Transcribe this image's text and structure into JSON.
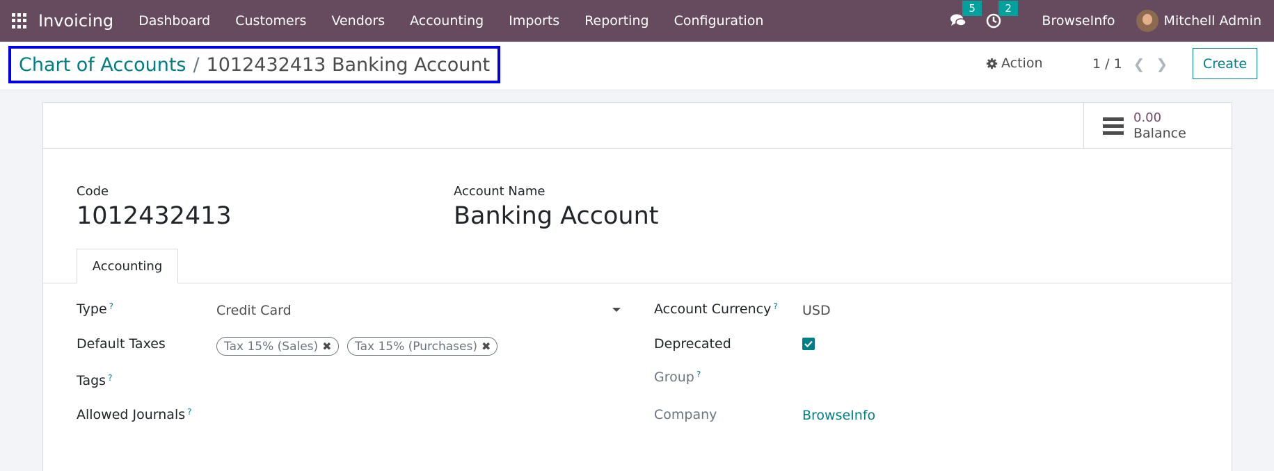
{
  "navbar": {
    "brand": "Invoicing",
    "menu": [
      "Dashboard",
      "Customers",
      "Vendors",
      "Accounting",
      "Imports",
      "Reporting",
      "Configuration"
    ],
    "messages_count": "5",
    "activities_count": "2",
    "company": "BrowseInfo",
    "user": "Mitchell Admin"
  },
  "breadcrumb": {
    "parent": "Chart of Accounts",
    "separator": "/",
    "current": "1012432413 Banking Account"
  },
  "control": {
    "action_label": "Action",
    "pager": "1 / 1",
    "create_label": "Create"
  },
  "balance": {
    "value": "0.00",
    "label": "Balance"
  },
  "form": {
    "code_label": "Code",
    "code_value": "1012432413",
    "name_label": "Account Name",
    "name_value": "Banking Account",
    "tab_label": "Accounting",
    "type_label": "Type",
    "type_value": "Credit Card",
    "taxes_label": "Default Taxes",
    "taxes": [
      "Tax 15% (Sales)",
      "Tax 15% (Purchases)"
    ],
    "tags_label": "Tags",
    "journals_label": "Allowed Journals",
    "currency_label": "Account Currency",
    "currency_value": "USD",
    "deprecated_label": "Deprecated",
    "deprecated_checked": true,
    "group_label": "Group",
    "company_label": "Company",
    "company_value": "BrowseInfo",
    "help_mark": "?"
  },
  "colors": {
    "navbar": "#664a5e",
    "accent": "#017e84",
    "badge": "#00a09d",
    "highlight_border": "#0000e6"
  }
}
